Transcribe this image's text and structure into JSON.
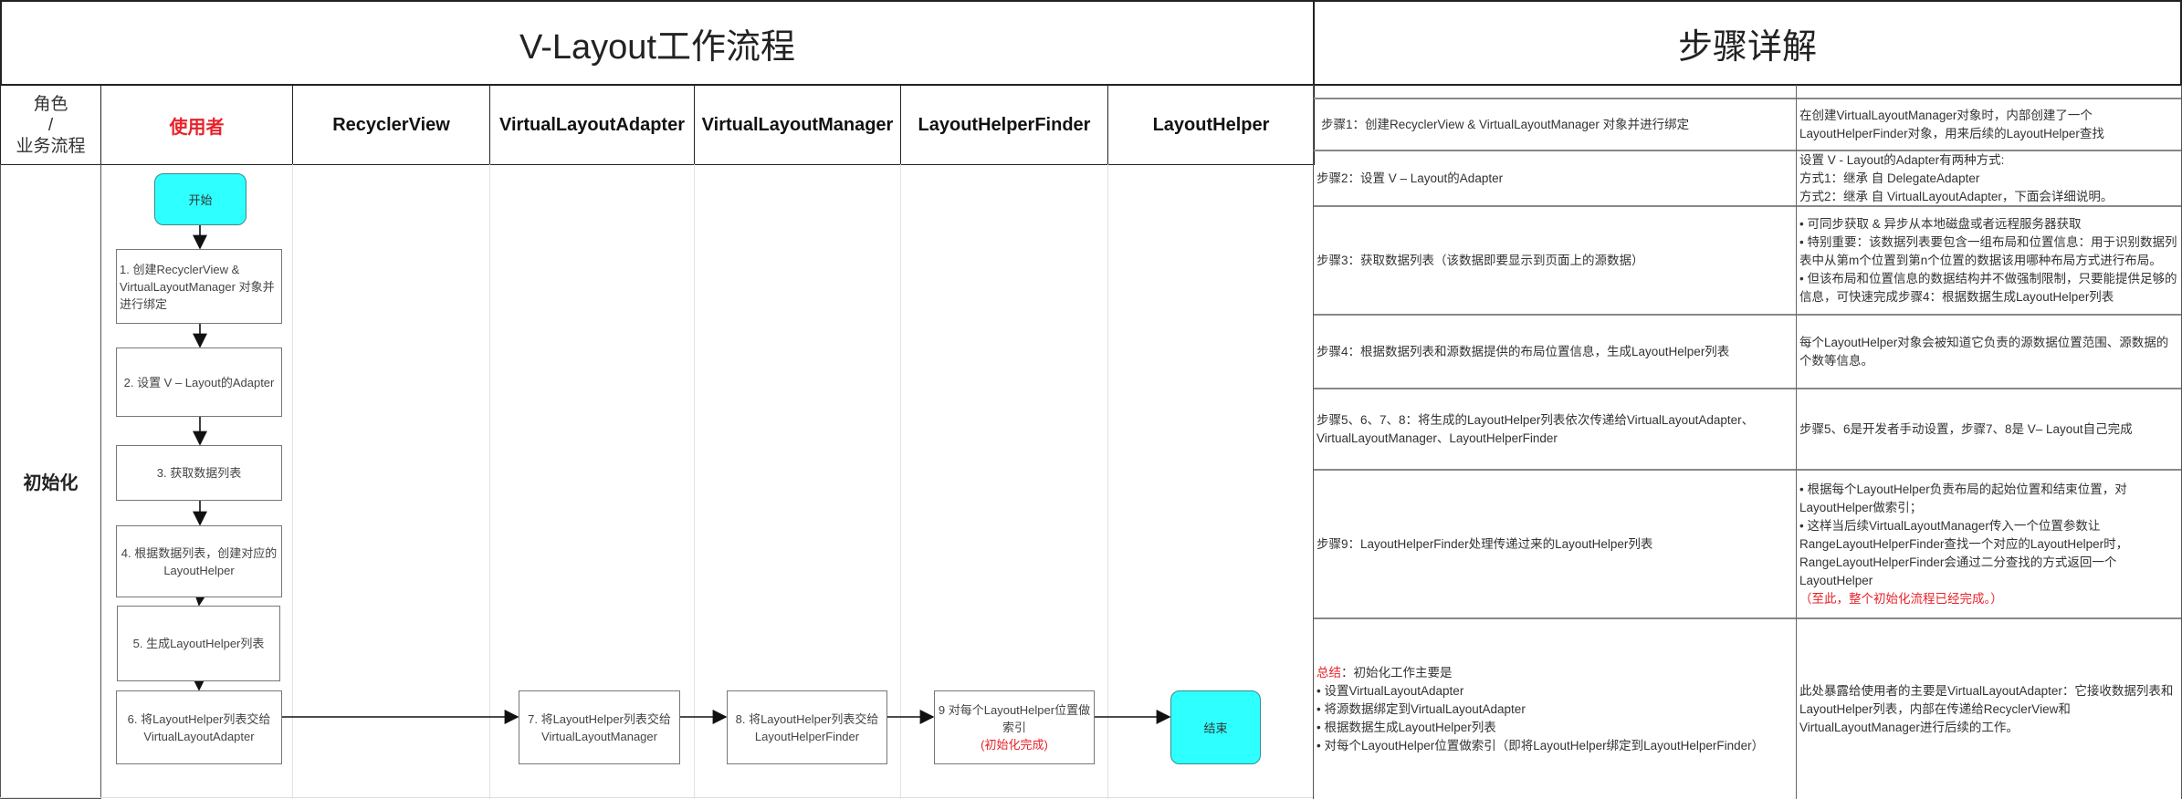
{
  "left_title": "V-Layout工作流程",
  "right_title": "步骤详解",
  "role_header": [
    "角色",
    "/",
    "业务流程"
  ],
  "lanes": [
    "使用者",
    "RecyclerView",
    "VirtualLayoutAdapter",
    "VirtualLayoutManager",
    "LayoutHelperFinder",
    "LayoutHelper"
  ],
  "phase": "初始化",
  "nodes": {
    "start": "开始",
    "s1": "1. 创建RecyclerView & VirtualLayoutManager 对象并进行绑定",
    "s2": "2. 设置 V – Layout的Adapter",
    "s3": "3. 获取数据列表",
    "s4": "4. 根据数据列表，创建对应的LayoutHelper",
    "s5": "5. 生成LayoutHelper列表",
    "s6": "6. 将LayoutHelper列表交给VirtualLayoutAdapter",
    "s7": "7. 将LayoutHelper列表交给VirtualLayoutManager",
    "s8": "8. 将LayoutHelper列表交给LayoutHelperFinder",
    "s9": "9 对每个LayoutHelper位置做索引",
    "s9_note": "(初始化完成)",
    "end": "结束"
  },
  "steps": [
    {
      "step": "步骤1：创建RecyclerView & VirtualLayoutManager 对象并进行绑定",
      "detail": [
        "在创建VirtualLayoutManager对象时，内部创建了一个LayoutHelperFinder对象，用来后续的LayoutHelper查找"
      ]
    },
    {
      "step": "步骤2：设置 V – Layout的Adapter",
      "detail": [
        "设置 V - Layout的Adapter有两种方式:",
        "方式1：继承 自 DelegateAdapter",
        "方式2：继承 自 VirtualLayoutAdapter，下面会详细说明。"
      ]
    },
    {
      "step": "步骤3：获取数据列表（该数据即要显示到页面上的源数据）",
      "detail": [
        "• 可同步获取 & 异步从本地磁盘或者远程服务器获取",
        "• 特别重要：该数据列表要包含一组布局和位置信息：用于识别数据列表中从第m个位置到第n个位置的数据该用哪种布局方式进行布局。",
        "• 但该布局和位置信息的数据结构并不做强制限制，只要能提供足够的信息，可快速完成步骤4：根据数据生成LayoutHelper列表"
      ]
    },
    {
      "step": "步骤4：根据数据列表和源数据提供的布局位置信息，生成LayoutHelper列表",
      "detail": [
        "每个LayoutHelper对象会被知道它负责的源数据位置范围、源数据的个数等信息。"
      ]
    },
    {
      "step": "步骤5、6、7、8：将生成的LayoutHelper列表依次传递给VirtualLayoutAdapter、VirtualLayoutManager、LayoutHelperFinder",
      "detail": [
        "步骤5、6是开发者手动设置，步骤7、8是 V– Layout自己完成"
      ]
    },
    {
      "step": "步骤9：LayoutHelperFinder处理传递过来的LayoutHelper列表",
      "detail": [
        "• 根据每个LayoutHelper负责布局的起始位置和结束位置，对LayoutHelper做索引；",
        "• 这样当后续VirtualLayoutManager传入一个位置参数让RangeLayoutHelperFinder查找一个对应的LayoutHelper时，RangeLayoutHelperFinder会通过二分查找的方式返回一个LayoutHelper"
      ],
      "note": "（至此，整个初始化流程已经完成。）"
    }
  ],
  "summary": {
    "label": "总结",
    "intro": "：初始化工作主要是",
    "items": [
      "• 设置VirtualLayoutAdapter",
      "• 将源数据绑定到VirtualLayoutAdapter",
      "• 根据数据生成LayoutHelper列表",
      "• 对每个LayoutHelper位置做索引（即将LayoutHelper绑定到LayoutHelperFinder）"
    ],
    "detail": "此处暴露给使用者的主要是VirtualLayoutAdapter：它接收数据列表和LayoutHelper列表，内部在传递给RecyclerView和VirtualLayoutManager进行后续的工作。"
  },
  "colors": {
    "terminal": "#2effff",
    "accent_red": "#e8222a"
  }
}
